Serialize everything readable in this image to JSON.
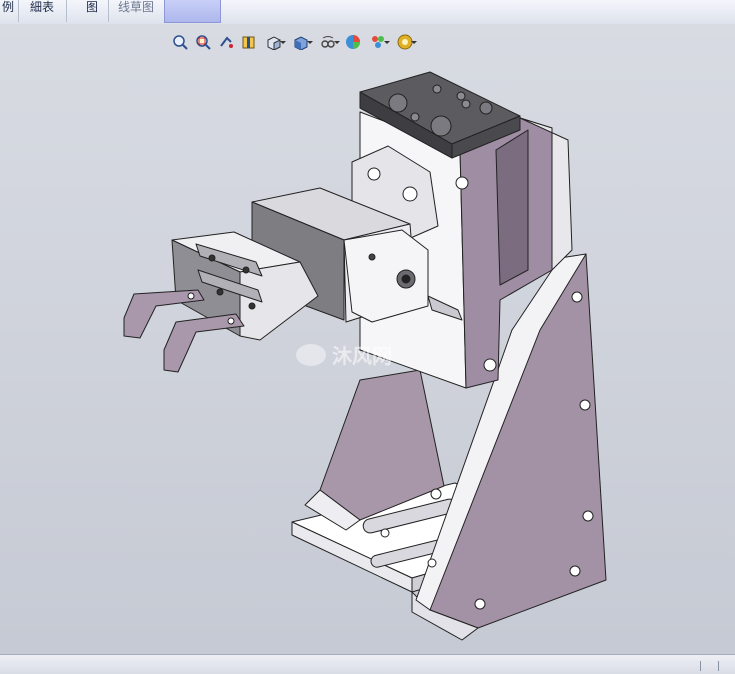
{
  "tabs": [
    {
      "label": "例",
      "dim": false
    },
    {
      "label": "細表",
      "dim": false
    },
    {
      "label": "图",
      "dim": false
    },
    {
      "label": "线草图",
      "dim": true
    },
    {
      "label": "",
      "dim": false
    }
  ],
  "hud_icons": [
    "zoom-to-fit-icon",
    "zoom-area-icon",
    "previous-view-icon",
    "section-view-icon",
    "view-orientation-icon",
    "display-style-icon",
    "hide-show-items-icon",
    "edit-appearance-icon",
    "apply-scene-icon",
    "view-settings-icon"
  ],
  "watermark": {
    "text": "沐风网"
  },
  "colors": {
    "part_face": "#ffffff",
    "part_side": "#e6e6ea",
    "part_shade": "#9a8aa0",
    "part_dark": "#6f6175",
    "top_plate": "#5a5a5e",
    "edge": "#222222"
  }
}
